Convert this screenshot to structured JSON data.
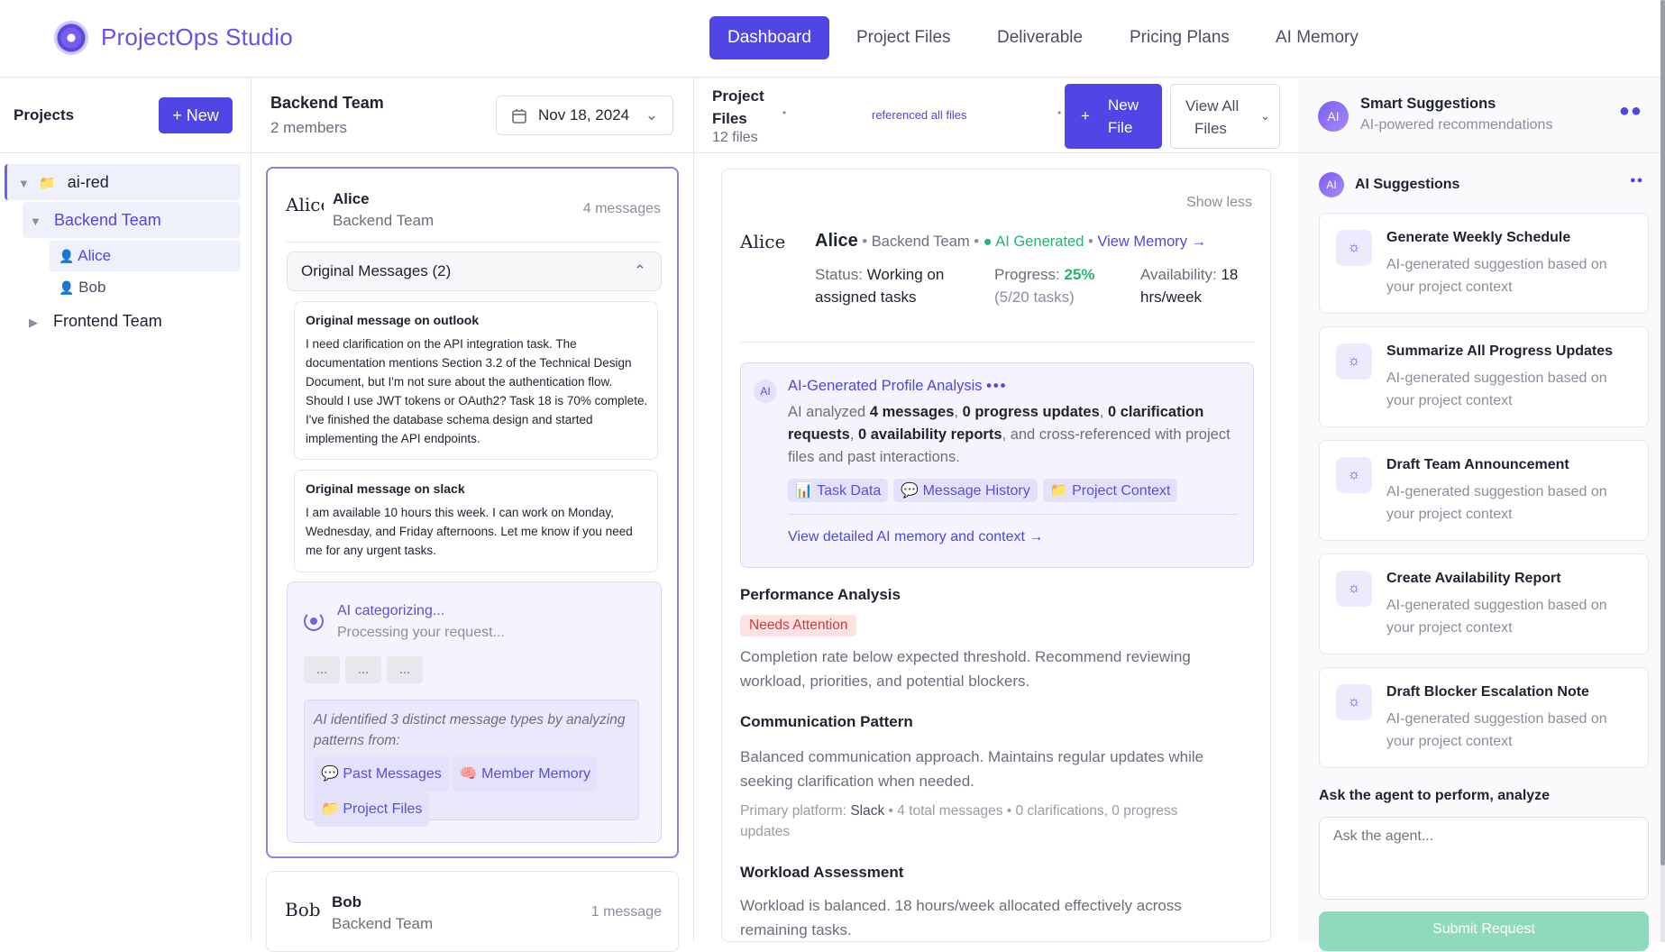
{
  "app": {
    "title": "ProjectOps Studio"
  },
  "nav": {
    "tabs": [
      "Dashboard",
      "Project Files",
      "Deliverable",
      "Pricing Plans",
      "AI Memory"
    ],
    "active": "Dashboard"
  },
  "projects": {
    "title": "Projects",
    "new_label": "+ New",
    "tree": {
      "root": "ai-red",
      "team1": "Backend Team",
      "member1": "Alice",
      "member2": "Bob",
      "team2": "Frontend Team"
    }
  },
  "team": {
    "name": "Backend Team",
    "members": "2 members",
    "date": "Nov 18, 2024",
    "alice": {
      "avatar_text": "Alice",
      "name": "Alice",
      "team": "Backend Team",
      "count": "4 messages",
      "original_header": "Original Messages (2)",
      "messages": [
        {
          "source": "Original message on outlook",
          "body": "I need clarification on the API integration task. The documentation mentions Section 3.2 of the Technical Design Document, but I'm not sure about the authentication flow. Should I use JWT tokens or OAuth2? Task 18 is 70% complete. I've finished the database schema design and started implementing the API endpoints."
        },
        {
          "source": "Original message on slack",
          "body": "I am available 10 hours this week. I can work on Monday, Wednesday, and Friday afternoons. Let me know if you need me for any urgent tasks."
        }
      ],
      "ai": {
        "title": "AI categorizing...",
        "sub": "Processing your request...",
        "placeholders": [
          "...",
          "...",
          "..."
        ],
        "note": "AI identified 3 distinct message types by analyzing patterns from:",
        "chips": [
          "💬 Past Messages",
          "🧠 Member Memory",
          "📁 Project Files"
        ]
      }
    },
    "bob": {
      "avatar_text": "Bob",
      "name": "Bob",
      "team": "Backend Team",
      "count": "1 message"
    }
  },
  "files": {
    "title_line1": "Project",
    "title_line2": "Files",
    "count": "12 files",
    "referenced": "referenced all files",
    "new_file_line1": "New",
    "new_file_line2": "File",
    "view_all_line1": "View All",
    "view_all_line2": "Files"
  },
  "profile": {
    "show_less": "Show less",
    "avatar_text": "Alice",
    "name": "Alice",
    "team": "Backend Team",
    "ai_generated": "AI Generated",
    "view_memory": "View Memory →",
    "status_label": "Status:",
    "status_line1": "Working on",
    "status_line2": "assigned tasks",
    "progress_label": "Progress:",
    "progress_value": "25%",
    "progress_detail": "(5/20 tasks)",
    "availability_label": "Availability:",
    "availability_value": "18",
    "availability_unit": "hrs/week",
    "analysis": {
      "title": "AI-Generated Profile Analysis",
      "t1": "AI analyzed ",
      "b1": "4 messages",
      "t2": ", ",
      "b2": "0 progress updates",
      "t3": ", ",
      "b3": "0 clarification requests",
      "t4": ", ",
      "b4": "0 availability reports",
      "t5": ", and cross-referenced with project files and past interactions.",
      "tags": [
        "📊 Task Data",
        "💬 Message History",
        "📁 Project Context"
      ],
      "link": "View detailed AI memory and context →"
    },
    "performance": {
      "title": "Performance Analysis",
      "badge": "Needs Attention",
      "text": "Completion rate below expected threshold. Recommend reviewing workload, priorities, and potential blockers."
    },
    "communication": {
      "title": "Communication Pattern",
      "text": "Balanced communication approach. Maintains regular updates while seeking clarification when needed.",
      "platform_label": "Primary platform:",
      "platform": "Slack",
      "stats": "• 4 total messages • 0 clarifications, 0 progress updates"
    },
    "workload": {
      "title": "Workload Assessment",
      "text": "Workload is balanced. 18 hours/week allocated effectively across remaining tasks."
    }
  },
  "suggestions": {
    "header_title": "Smart Suggestions",
    "header_sub": "AI-powered recommendations",
    "section_title": "AI Suggestions",
    "avatar_text": "AI",
    "items": [
      {
        "title": "Generate Weekly Schedule",
        "desc": "AI-generated suggestion based on your project context"
      },
      {
        "title": "Summarize All Progress Updates",
        "desc": "AI-generated suggestion based on your project context"
      },
      {
        "title": "Draft Team Announcement",
        "desc": "AI-generated suggestion based on your project context"
      },
      {
        "title": "Create Availability Report",
        "desc": "AI-generated suggestion based on your project context"
      },
      {
        "title": "Draft Blocker Escalation Note",
        "desc": "AI-generated suggestion based on your project context"
      }
    ],
    "ask_label": "Ask the agent to perform, analyze",
    "ask_placeholder": "Ask the agent...",
    "submit": "Submit Request"
  },
  "colors": {
    "accent": "#4f46e5",
    "brand": "#6d4fe0",
    "success": "#22b573",
    "danger_bg": "#fde2e2",
    "danger_text": "#d03a3a"
  }
}
